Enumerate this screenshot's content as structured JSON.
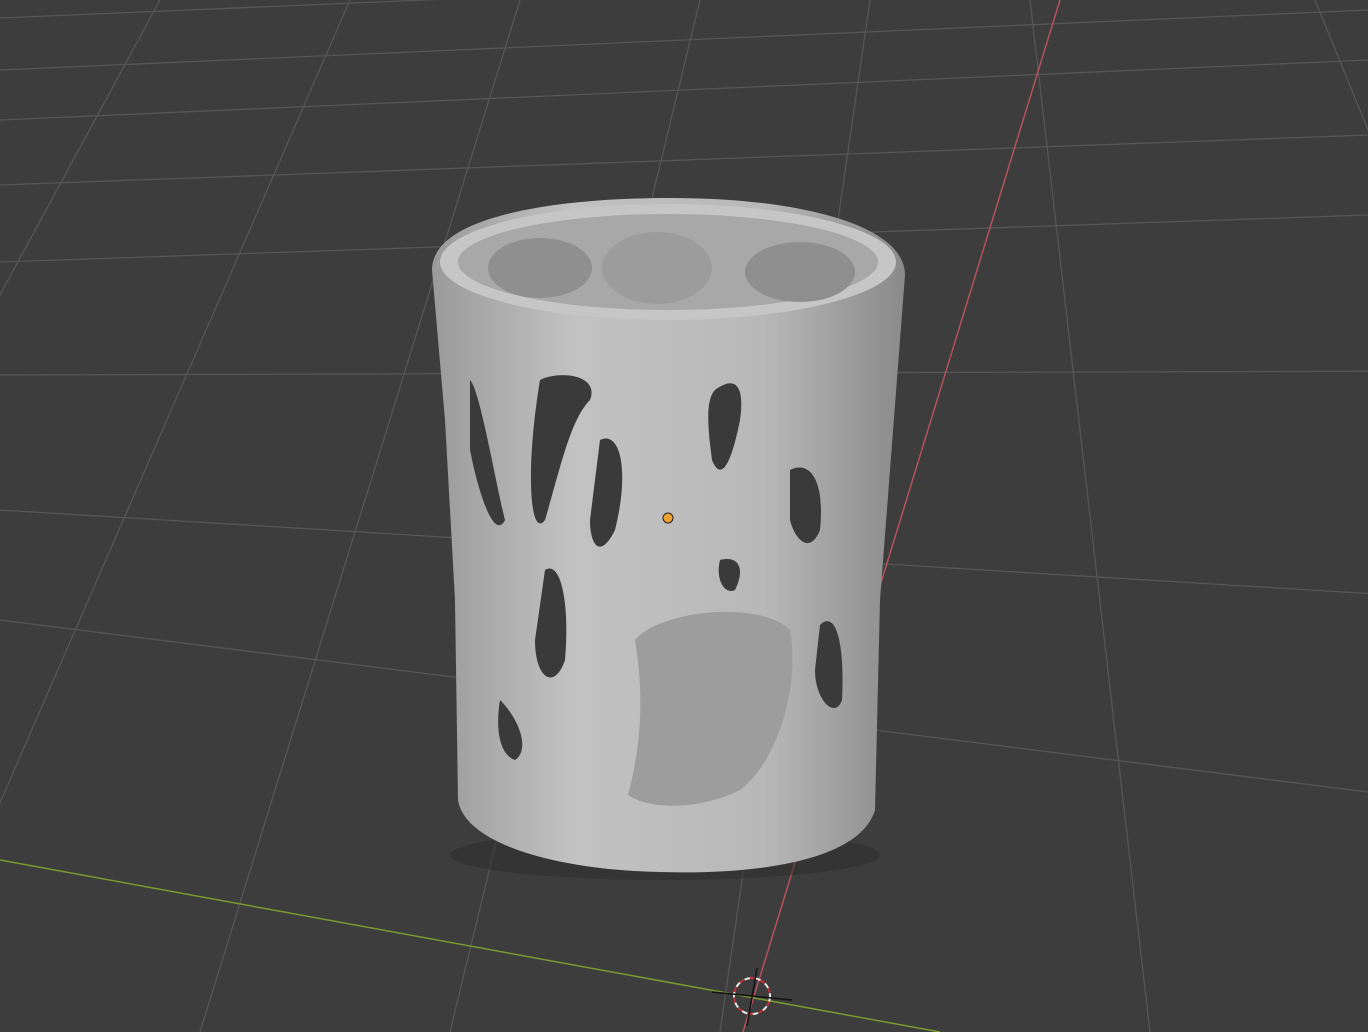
{
  "viewport": {
    "background": "#3d3d3d",
    "grid_color": "#545454",
    "x_axis_color": "#b5525e",
    "y_axis_color": "#7a9a2e",
    "object_color": "#b4b4b4",
    "origin_color": "#f0a030"
  }
}
